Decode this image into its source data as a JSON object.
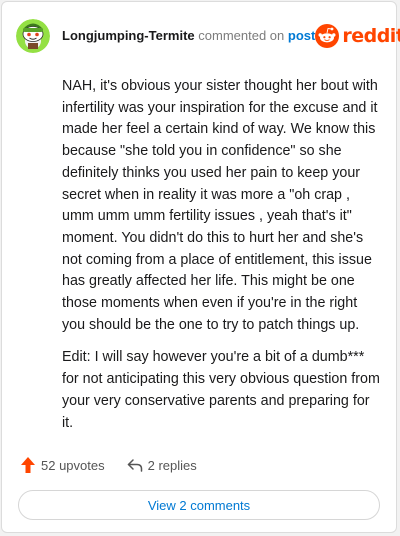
{
  "header": {
    "username": "Longjumping-Termite",
    "action_text": "commented on",
    "link_text": "post",
    "brand_text": "reddit"
  },
  "comment": {
    "paragraphs": [
      "NAH, it's obvious your sister thought her bout with infertility was your inspiration for the excuse and it made her feel a certain kind of way. We know this because \"she told you in confidence\" so she definitely thinks you used her pain to keep your secret when in reality it was more a \"oh crap , umm umm umm fertility issues , yeah that's it\" moment. You didn't do this to hurt her and she's not coming from a place of entitlement, this issue has greatly affected her life. This might be one those moments when even if you're in the right you should be the one to try to patch things up.",
      "Edit: I will say however you're a bit of a dumb*** for not anticipating this very obvious question from your very conservative parents and preparing for it."
    ]
  },
  "actions": {
    "upvotes_label": "52 upvotes",
    "replies_label": "2 replies"
  },
  "footer": {
    "view_comments_label": "View 2 comments"
  },
  "icons": {
    "avatar": "snoo-avatar-icon",
    "brand": "reddit-snoo-icon",
    "upvote": "upvote-arrow-icon",
    "reply": "reply-arrow-icon"
  },
  "colors": {
    "brand": "#ff4500",
    "link": "#0079d3",
    "upvote": "#ff4500",
    "avatar_bg": "#94e044"
  }
}
